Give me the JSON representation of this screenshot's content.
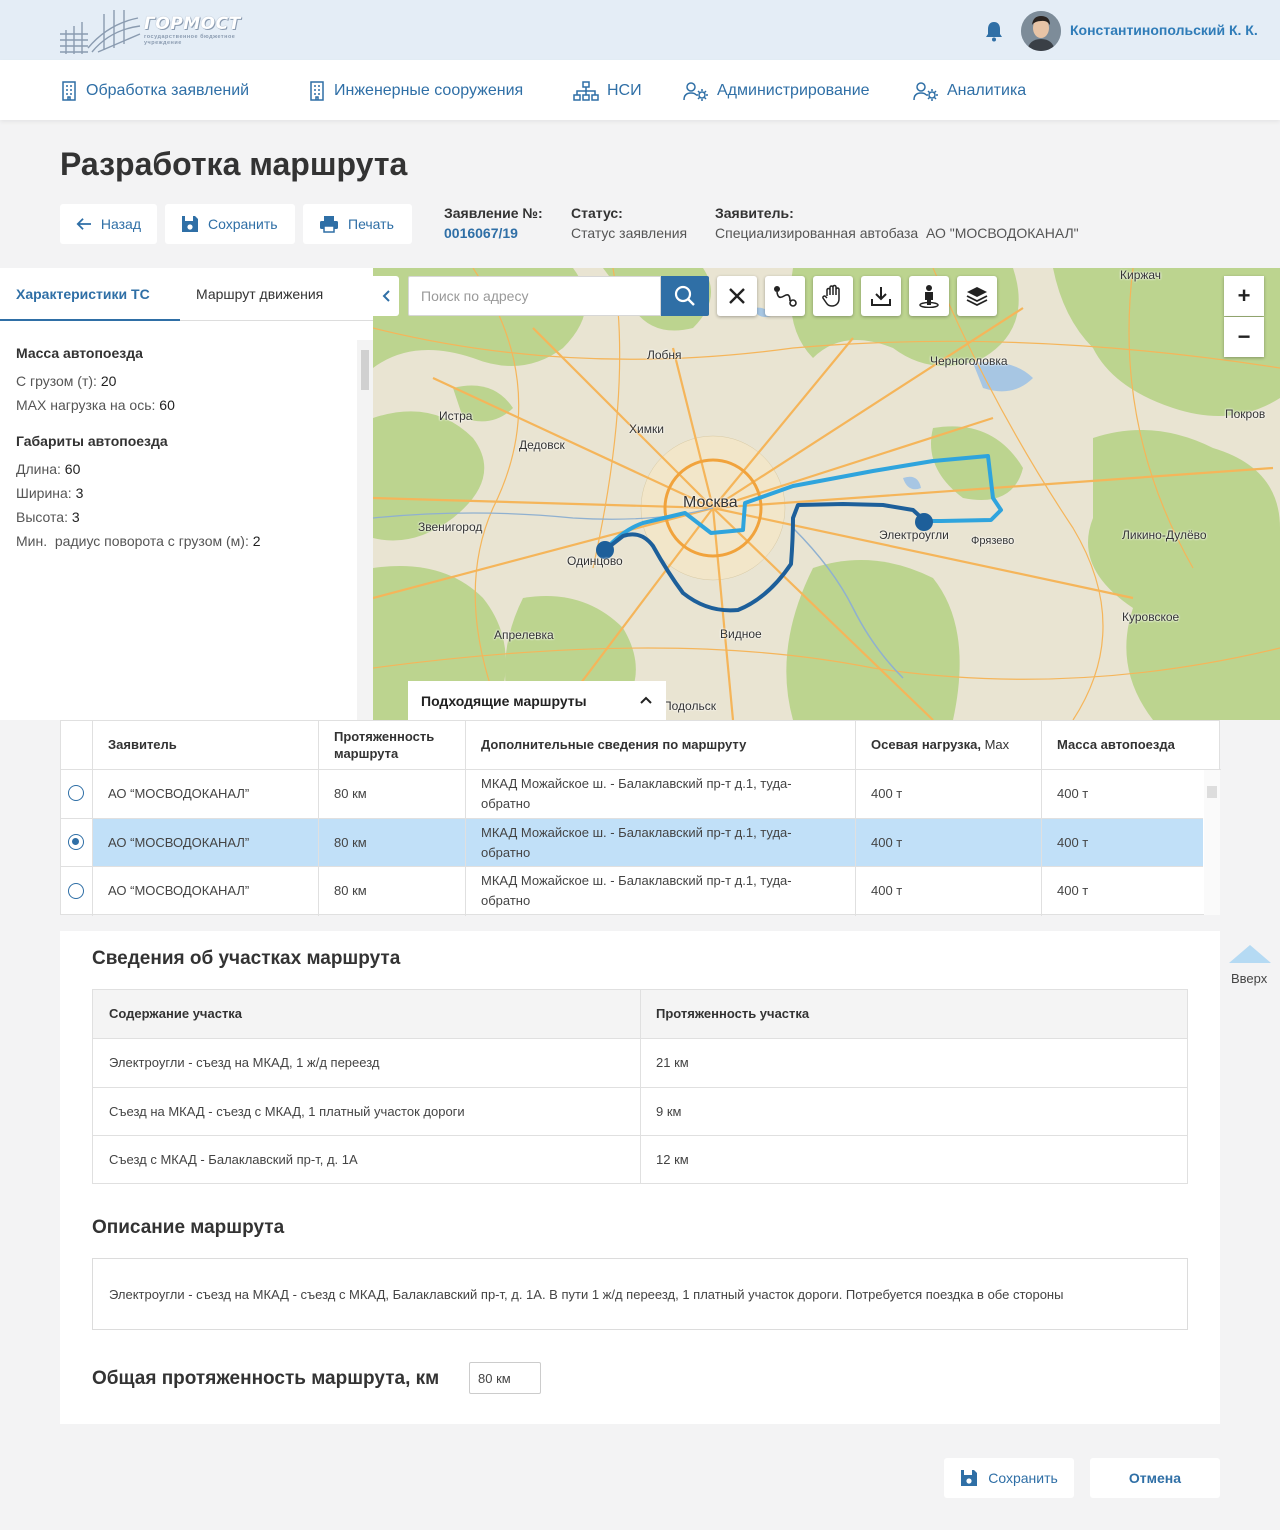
{
  "header": {
    "logo_title": "ГОРМОСТ",
    "logo_subtitle": "государственное бюджетное учреждение",
    "user_name": "Константинопольский К. К."
  },
  "nav": {
    "items": [
      {
        "label": "Обработка заявлений",
        "icon": "building-icon"
      },
      {
        "label": "Инженерные сооружения",
        "icon": "building-icon"
      },
      {
        "label": "НСИ",
        "icon": "hierarchy-icon"
      },
      {
        "label": "Администрирование",
        "icon": "users-gear-icon"
      },
      {
        "label": "Аналитика",
        "icon": "users-gear-icon"
      }
    ]
  },
  "page": {
    "title": "Разработка маршрута",
    "back_label": "Назад",
    "save_label": "Сохранить",
    "print_label": "Печать"
  },
  "meta": {
    "application_label": "Заявление №:",
    "application_value": "0016067/19",
    "status_label": "Статус:",
    "status_value": "Статус заявления",
    "applicant_label": "Заявитель:",
    "applicant_value": "Специализированная автобаза  АО \"МОСВОДОКАНАЛ\""
  },
  "left_panel": {
    "tabs": [
      "Характеристики ТС",
      "Маршрут движения"
    ],
    "mass_heading": "Масса автопоезда",
    "cargo_label": "С грузом (т):",
    "cargo_value": "20",
    "axle_label": "MAX нагрузка на ось:",
    "axle_value": "60",
    "dims_heading": "Габариты автопоезда",
    "length_label": "Длина:",
    "length_value": "60",
    "width_label": "Ширина:",
    "width_value": "3",
    "height_label": "Высота:",
    "height_value": "3",
    "radius_label": "Мин.  радиус поворота с грузом (м):",
    "radius_value": "2"
  },
  "map": {
    "search_placeholder": "Поиск по адресу",
    "routes_panel_label": "Подходящие маршруты",
    "zoom_in": "+",
    "zoom_out": "−",
    "labels": [
      "Фрязево",
      "Киржач",
      "Лобня",
      "Черноголовка",
      "Истра",
      "Химки",
      "Покров",
      "Дедовск",
      "Москва",
      "Звенигород",
      "Электроугли",
      "Ликино-Дулёво",
      "Одинцово",
      "Куровское",
      "Апрелевка",
      "Видное",
      "Подольск"
    ],
    "route_colors": {
      "light": "#2fa4dd",
      "dark": "#1d5f9a"
    }
  },
  "routes_table": {
    "headers": [
      "Заявитель",
      "Протяженность маршрута",
      "Дополнительные сведения по маршруту",
      "Осевая нагрузка",
      "Max",
      "Масса автопоезда"
    ],
    "rows": [
      {
        "applicant": "АО “МОСВОДОКАНАЛ”",
        "length": "80 км",
        "info": "МКАД Можайское ш. - Балаклавский пр-т д.1, туда-обратно",
        "axle": "400 т",
        "mass": "400 т",
        "selected": false
      },
      {
        "applicant": "АО “МОСВОДОКАНАЛ”",
        "length": "80 км",
        "info": "МКАД Можайское ш. - Балаклавский пр-т д.1, туда-обратно",
        "axle": "400 т",
        "mass": "400 т",
        "selected": true
      },
      {
        "applicant": "АО “МОСВОДОКАНАЛ”",
        "length": "80 км",
        "info": "МКАД Можайское ш. - Балаклавский пр-т д.1, туда-обратно",
        "axle": "400 т",
        "mass": "400 т",
        "selected": false
      }
    ]
  },
  "segments": {
    "title": "Сведения об участках маршрута",
    "headers": [
      "Содержание участка",
      "Протяженность участка"
    ],
    "rows": [
      {
        "content": "Электроугли - съезд на МКАД, 1 ж/д переезд",
        "length": "21 км"
      },
      {
        "content": "Съезд на МКАД - съезд с МКАД, 1 платный участок дороги",
        "length": "9 км"
      },
      {
        "content": "Съезд с МКАД - Балаклавский пр-т, д. 1А",
        "length": "12 км"
      }
    ]
  },
  "description": {
    "title": "Описание маршрута",
    "text": "Электроугли - съезд на МКАД - съезд с МКАД, Балаклавский пр-т, д. 1А. В пути 1 ж/д переезд, 1 платный участок дороги. Потребуется поездка в обе стороны"
  },
  "total": {
    "label": "Общая протяженность маршрута, км",
    "value": "80 км"
  },
  "scroll_top_label": "Вверх",
  "footer": {
    "save_label": "Сохранить",
    "cancel_label": "Отмена"
  },
  "colors": {
    "accent": "#2f6fa6",
    "header_bg": "#e4edf6",
    "selected_row": "#c1e0f8"
  }
}
